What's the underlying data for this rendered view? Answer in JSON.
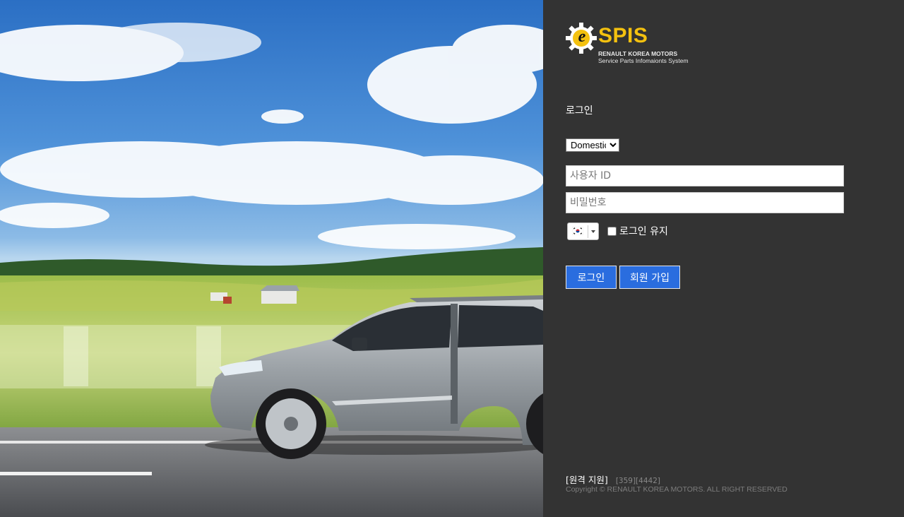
{
  "colors": {
    "panel_bg": "#333333",
    "accent_button": "#2a6ddf",
    "logo_yellow": "#f4c10f"
  },
  "hero": {
    "scene": "silver SUV driving on road with countryside and blue sky"
  },
  "logo": {
    "icon": "e-gear-logo-icon",
    "letter": "e",
    "wordmark": "SPIS",
    "subtitle_1": "RENAULT KOREA MOTORS",
    "subtitle_2": "Service Parts Infomaionts System"
  },
  "login": {
    "title": "로그인",
    "region_selected": "Domestic",
    "user_id_placeholder": "사용자 ID",
    "password_placeholder": "비밀번호",
    "language_icon": "korea-flag-icon",
    "remember_label": "로그인 유지",
    "login_button": "로그인",
    "signup_button": "회원 가입"
  },
  "footer": {
    "remote_support": "[원격 지원]",
    "remote_codes": "[359][4442]",
    "copyright": "Copyright © RENAULT KOREA MOTORS. ALL RIGHT RESERVED"
  }
}
